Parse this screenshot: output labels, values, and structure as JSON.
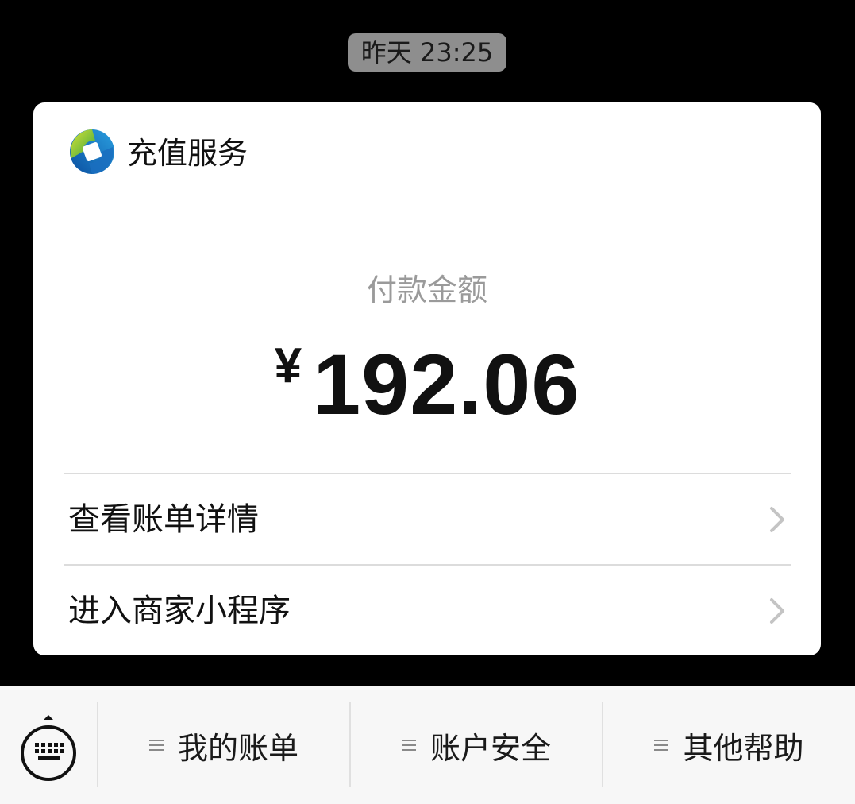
{
  "timestamp": "昨天 23:25",
  "card": {
    "merchant_name": "充值服务",
    "merchant_logo_icon": "merchant-swirl-logo-icon",
    "amount_label": "付款金额",
    "currency_symbol": "¥",
    "amount_value": "192.06",
    "rows": [
      {
        "label": "查看账单详情",
        "icon": "chevron-right-icon"
      },
      {
        "label": "进入商家小程序",
        "icon": "chevron-right-icon"
      }
    ]
  },
  "bottom_bar": {
    "keyboard_icon": "keyboard-icon",
    "menu": [
      {
        "label": "我的账单",
        "icon": "menu-lines-icon"
      },
      {
        "label": "账户安全",
        "icon": "menu-lines-icon"
      },
      {
        "label": "其他帮助",
        "icon": "menu-lines-icon"
      }
    ]
  },
  "colors": {
    "background": "#000000",
    "card": "#ffffff",
    "timestamp_bg": "#8e8e8e",
    "secondary_text": "#9a9a9a",
    "bottom_bar": "#f7f7f7"
  }
}
